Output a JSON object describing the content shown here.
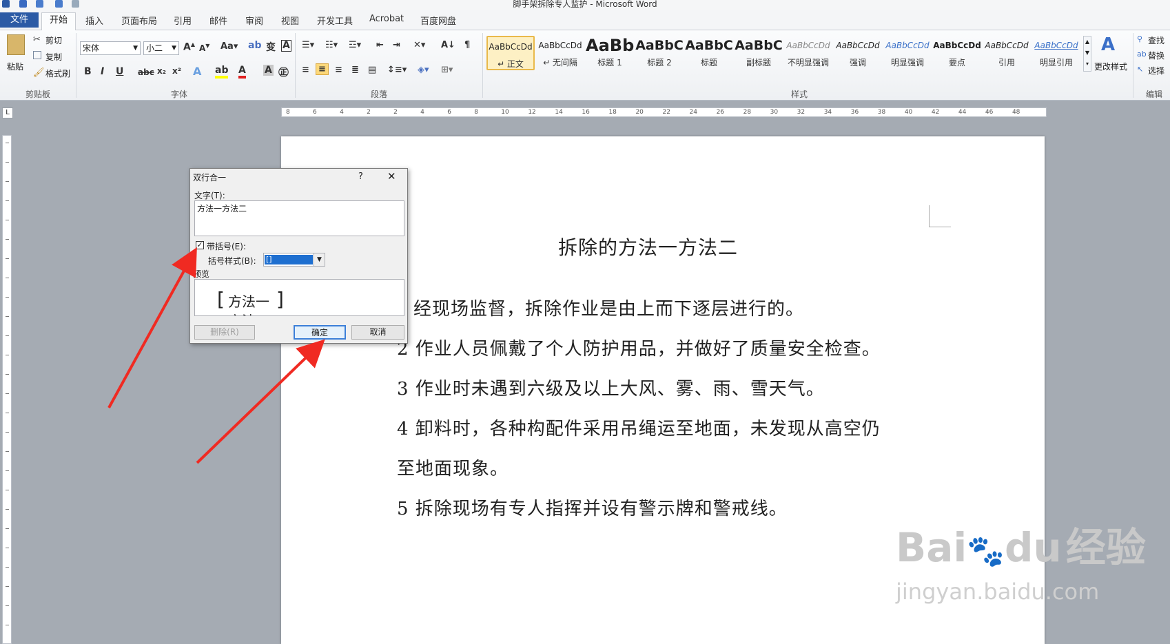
{
  "window": {
    "title": "脚手架拆除专人监护  -  Microsoft Word"
  },
  "tabs": [
    "文件",
    "开始",
    "插入",
    "页面布局",
    "引用",
    "邮件",
    "审阅",
    "视图",
    "开发工具",
    "Acrobat",
    "百度网盘"
  ],
  "clipboard": {
    "paste": "粘贴",
    "cut": "剪切",
    "copy": "复制",
    "format_painter": "格式刷",
    "label": "剪贴板"
  },
  "font": {
    "name": "宋体",
    "size": "小二",
    "label": "字体"
  },
  "paragraph": {
    "label": "段落"
  },
  "styles": {
    "label": "样式",
    "items": [
      {
        "sample": "AaBbCcDd",
        "name": "↵ 正文"
      },
      {
        "sample": "AaBbCcDd",
        "name": "↵ 无间隔"
      },
      {
        "sample": "AaBb",
        "name": "标题 1"
      },
      {
        "sample": "AaBbC",
        "name": "标题 2"
      },
      {
        "sample": "AaBbC",
        "name": "标题"
      },
      {
        "sample": "AaBbC",
        "name": "副标题"
      },
      {
        "sample": "AaBbCcDd",
        "name": "不明显强调"
      },
      {
        "sample": "AaBbCcDd",
        "name": "强调"
      },
      {
        "sample": "AaBbCcDd",
        "name": "明显强调"
      },
      {
        "sample": "AaBbCcDd",
        "name": "要点"
      },
      {
        "sample": "AaBbCcDd",
        "name": "引用"
      },
      {
        "sample": "AaBbCcDd",
        "name": "明显引用"
      }
    ],
    "change": "更改样式"
  },
  "editing": {
    "find": "查找",
    "replace": "替换",
    "select": "选择",
    "label": "编辑"
  },
  "document": {
    "title": "拆除的方法一方法二",
    "lines": [
      "经现场监督，拆除作业是由上而下逐层进行的。",
      "2 作业人员佩戴了个人防护用品，并做好了质量安全检查。",
      "3 作业时未遇到六级及以上大风、雾、雨、雪天气。",
      "4  卸料时，各种构配件采用吊绳运至地面，未发现从高空仍",
      "至地面现象。",
      "5 拆除现场有专人指挥并设有警示牌和警戒线。"
    ]
  },
  "dialog": {
    "title": "双行合一",
    "help": "?",
    "close": "✕",
    "text_label": "文字(T):",
    "text_value": "方法一方法二",
    "bracket_checkbox": "带括号(E):",
    "bracket_checked": true,
    "bracket_style_label": "括号样式(B):",
    "bracket_style_value": "[]",
    "preview_label": "预览",
    "preview_text": "方法一",
    "preview_text2": "方法二",
    "delete_button": "删除(R)",
    "ok_button": "确定",
    "cancel_button": "取消"
  },
  "ruler_numbers": [
    "8",
    "6",
    "4",
    "2",
    "2",
    "4",
    "6",
    "8",
    "10",
    "12",
    "14",
    "16",
    "18",
    "20",
    "22",
    "24",
    "26",
    "28",
    "30",
    "32",
    "34",
    "36",
    "38",
    "40",
    "42",
    "44",
    "46",
    "48"
  ],
  "watermark": {
    "brand": "Bai",
    "brand2": "du",
    "brand3": "经验",
    "url": "jingyan.baidu.com"
  },
  "colors": {
    "accent": "#2b5aa5",
    "arrow": "#f02a22",
    "selection": "#1e6fd0"
  }
}
